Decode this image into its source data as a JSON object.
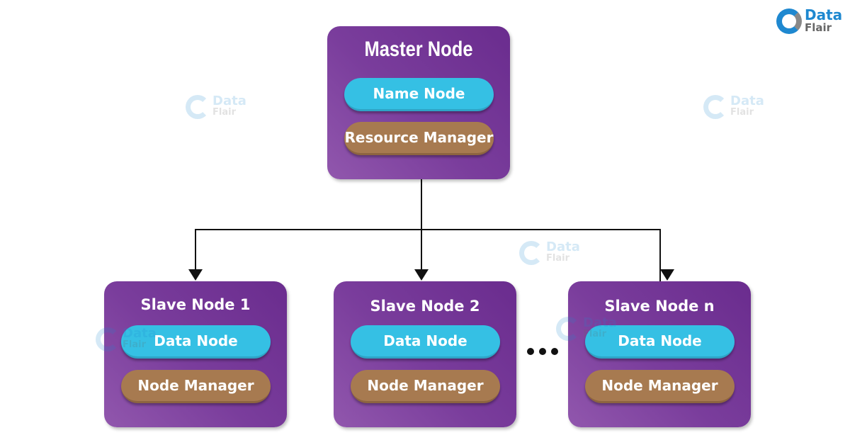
{
  "logo": {
    "line1": "Data",
    "line2": "Flair"
  },
  "master": {
    "title": "Master Node",
    "components": [
      "Name Node",
      "Resource Manager"
    ]
  },
  "slaves": [
    {
      "title": "Slave Node 1",
      "components": [
        "Data Node",
        "Node Manager"
      ]
    },
    {
      "title": "Slave Node 2",
      "components": [
        "Data Node",
        "Node Manager"
      ]
    },
    {
      "title": "Slave Node n",
      "components": [
        "Data Node",
        "Node Manager"
      ]
    }
  ],
  "colors": {
    "node_box": "#7a3d9c",
    "data_component": "#35c0e4",
    "manager_component": "#a77a50"
  }
}
